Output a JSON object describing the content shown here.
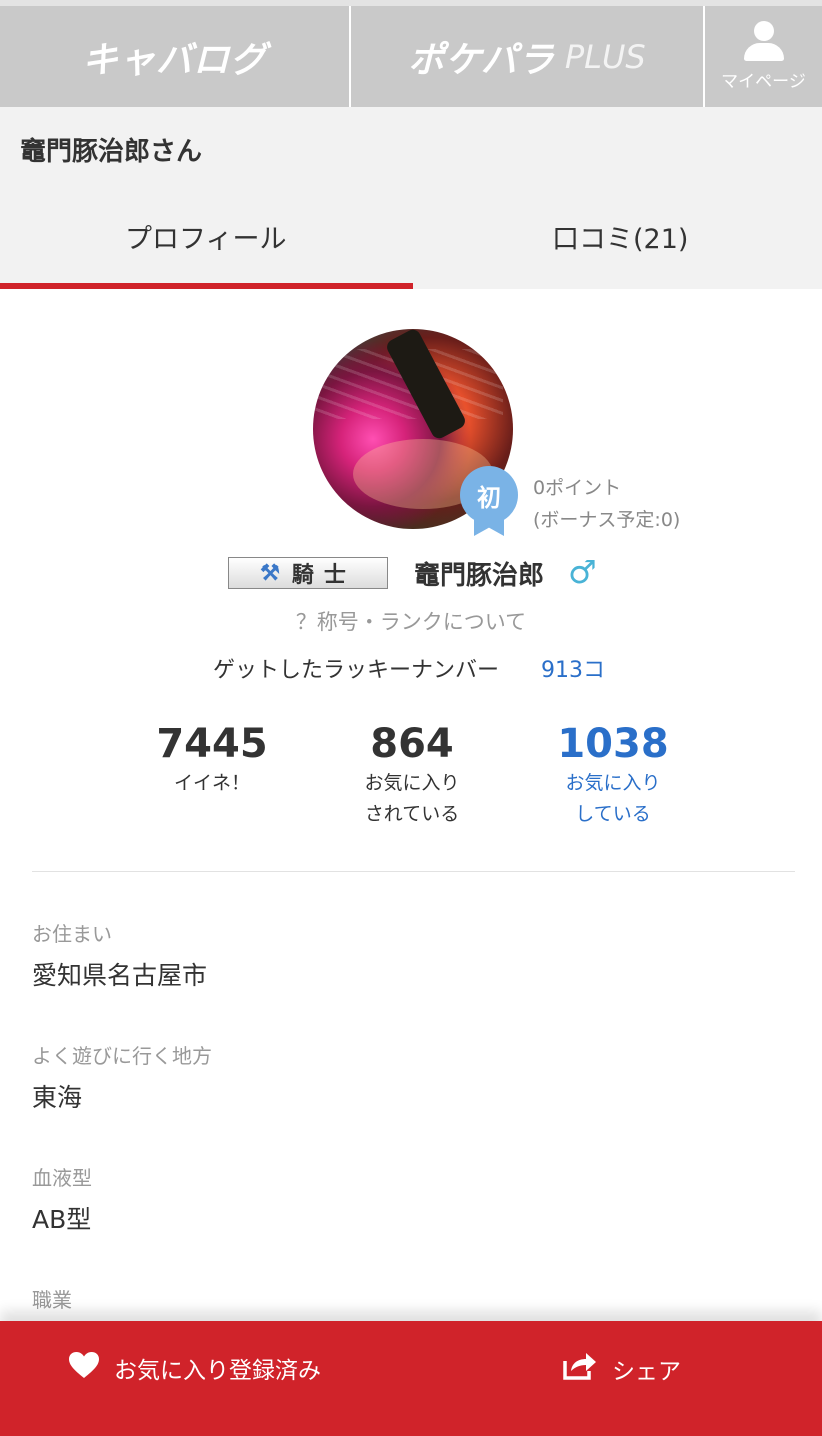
{
  "topbar": {
    "logo_left": "キャバログ",
    "logo_right": "ポケパラ",
    "logo_right_plus": "PLUS",
    "mypage_label": "マイページ"
  },
  "page_title": "竈門豚治郎さん",
  "tabs": [
    {
      "label": "プロフィール",
      "active": true
    },
    {
      "label": "口コミ(21)",
      "active": false
    }
  ],
  "profile": {
    "badge": "初",
    "points": "0ポイント",
    "bonus": "(ボーナス予定:0)",
    "rank_icon": "crossed-axes-icon",
    "rank_title": "騎士",
    "username": "竈門豚治郎",
    "gender_symbol": "♂",
    "rank_info_link": "？称号・ランクについて",
    "lucky_label": "ゲットしたラッキーナンバー",
    "lucky_value": "913コ"
  },
  "stats": [
    {
      "value": "7445",
      "label_line1": "イイネ！",
      "label_line2": ""
    },
    {
      "value": "864",
      "label_line1": "お気に入り",
      "label_line2": "されている"
    },
    {
      "value": "1038",
      "label_line1": "お気に入り",
      "label_line2": "している"
    }
  ],
  "fields": [
    {
      "label": "お住まい",
      "value": "愛知県名古屋市"
    },
    {
      "label": "よく遊びに行く地方",
      "value": "東海"
    },
    {
      "label": "血液型",
      "value": "AB型"
    },
    {
      "label": "職業",
      "value": ""
    }
  ],
  "bottombar": {
    "favorite_label": "お気に入り登録済み",
    "share_label": "シェア"
  },
  "colors": {
    "accent_red": "#d0232a",
    "link_blue": "#2a6fc9",
    "header_gray": "#c9c9c9",
    "badge_blue": "#7ab3e6"
  }
}
